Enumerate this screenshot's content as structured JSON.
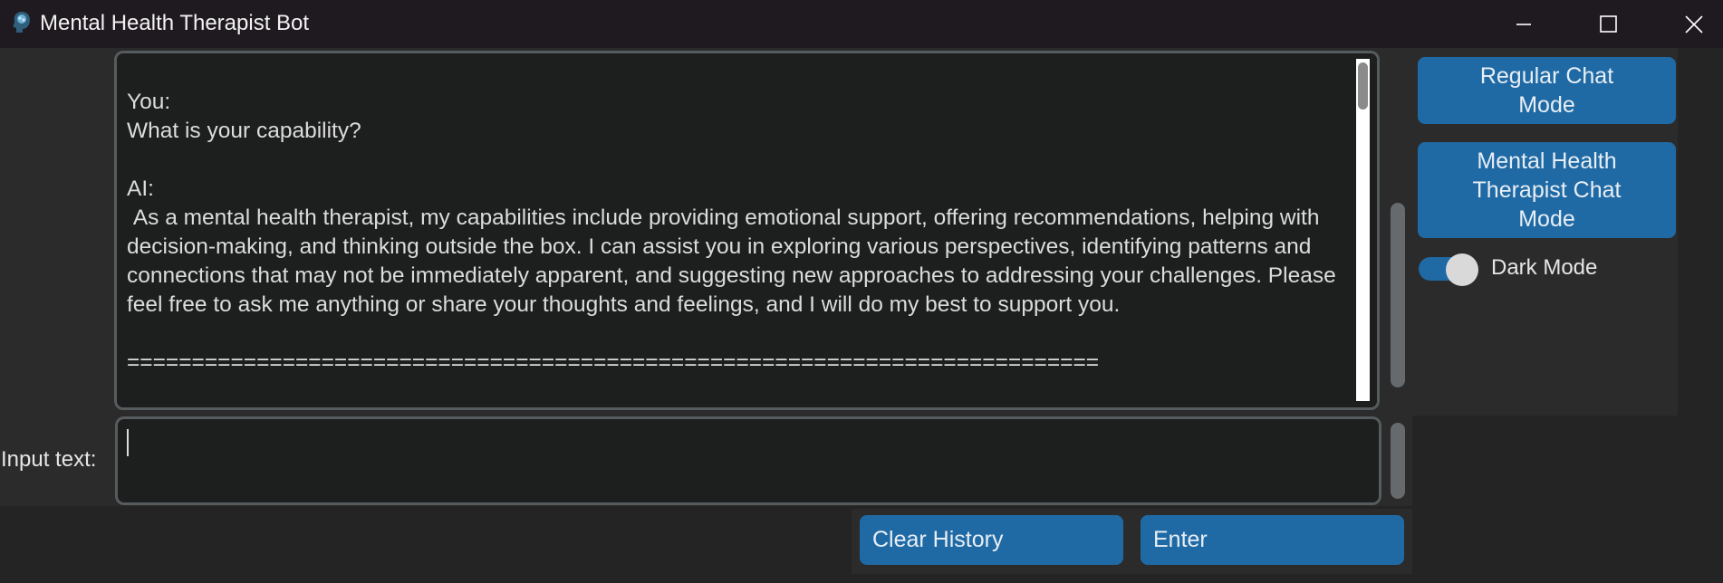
{
  "window": {
    "title": "Mental Health Therapist Bot",
    "icon": "brain-head-icon",
    "controls": [
      "minimize-icon",
      "maximize-icon",
      "close-icon"
    ]
  },
  "chat": {
    "transcript": "You:\nWhat is your capability?\n\nAI:\n As a mental health therapist, my capabilities include providing emotional support, offering recommendations, helping with decision-making, and thinking outside the box. I can assist you in exploring various perspectives, identifying patterns and connections that may not be immediately apparent, and suggesting new approaches to addressing your challenges. Please feel free to ask me anything or share your thoughts and feelings, and I will do my best to support you.\n\n==========================================================================="
  },
  "sidebar": {
    "regular_mode_label": "Regular Chat Mode",
    "therapist_mode_label": "Mental Health Therapist Chat Mode",
    "dark_mode_label": "Dark Mode",
    "dark_mode_on": true
  },
  "input": {
    "label": "Input text:",
    "value": ""
  },
  "actions": {
    "clear_label": "Clear History",
    "enter_label": "Enter"
  },
  "colors": {
    "accent": "#1f6aa5",
    "background": "#242424",
    "panel": "#2b2b2b",
    "textbox": "#1d1e1e"
  }
}
